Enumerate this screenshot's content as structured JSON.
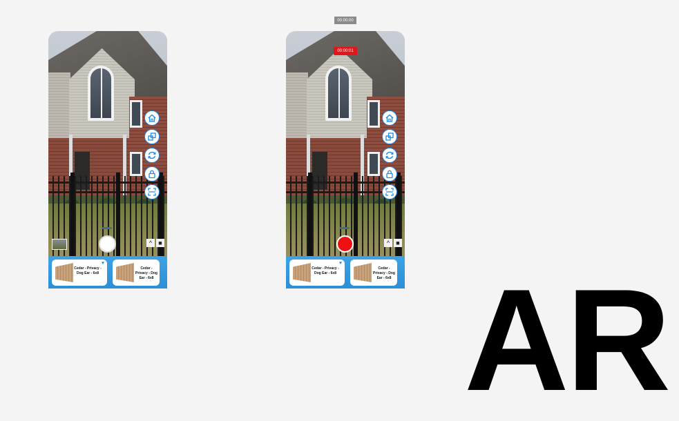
{
  "recording_timer": "00:00:00",
  "recording_elapsed": "00:00:01",
  "brand_text": "AR",
  "tool_buttons": [
    {
      "icon": "home-icon"
    },
    {
      "icon": "scale-icon"
    },
    {
      "icon": "rotate-icon"
    },
    {
      "icon": "lock-icon"
    },
    {
      "icon": "scan-frame-icon"
    }
  ],
  "products": [
    {
      "name": "Cedar - Privacy - Dog Ear - 6x8",
      "favorited": true
    },
    {
      "name": "Cedar - Privacy - Dog Ear - 6x8",
      "favorited": false
    }
  ],
  "colors": {
    "accent": "#1e88e5",
    "record": "#e3141a",
    "tray": "#2b8fd6"
  }
}
